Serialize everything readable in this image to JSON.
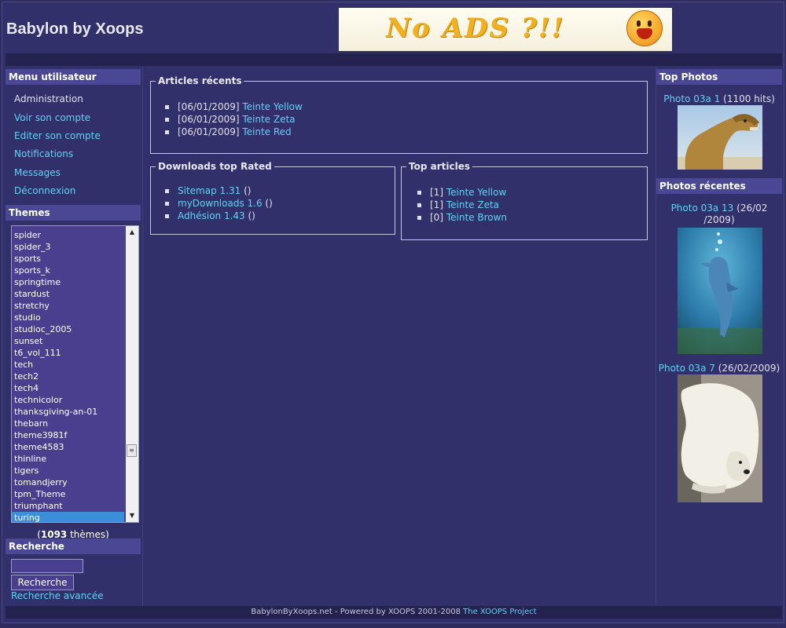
{
  "header": {
    "site_title": "Babylon by Xoops",
    "banner_text": "No ADS ?!!"
  },
  "user_menu": {
    "title": "Menu utilisateur",
    "items": [
      "Administration",
      "Voir son compte",
      "Editer son compte",
      "Notifications",
      "Messages",
      "Déconnexion"
    ]
  },
  "themes": {
    "title": "Themes",
    "options": [
      "spider",
      "spider_3",
      "sports",
      "sports_k",
      "springtime",
      "stardust",
      "stretchy",
      "studio",
      "studioc_2005",
      "sunset",
      "t6_vol_111",
      "tech",
      "tech2",
      "tech4",
      "technicolor",
      "thanksgiving-an-01",
      "thebarn",
      "theme3981f",
      "theme4583",
      "thinline",
      "tigers",
      "tomandjerry",
      "tpm_Theme",
      "triumphant",
      "turing"
    ],
    "selected": "turing",
    "count": "1093",
    "count_suffix": " thèmes)",
    "count_prefix": "("
  },
  "search": {
    "title": "Recherche",
    "button": "Recherche",
    "advanced": "Recherche avancée"
  },
  "articles_recents": {
    "legend": "Articles récents",
    "items": [
      {
        "date": "[06/01/2009]",
        "title": "Teinte Yellow"
      },
      {
        "date": "[06/01/2009]",
        "title": "Teinte Zeta"
      },
      {
        "date": "[06/01/2009]",
        "title": "Teinte Red"
      }
    ]
  },
  "downloads": {
    "legend": "Downloads top Rated",
    "items": [
      {
        "title": "Sitemap 1.31",
        "suffix": "()"
      },
      {
        "title": "myDownloads 1.6",
        "suffix": "()"
      },
      {
        "title": "Adhésion 1.43",
        "suffix": "()"
      }
    ]
  },
  "top_articles": {
    "legend": "Top articles",
    "items": [
      {
        "rank": "[1]",
        "title": "Teinte Yellow"
      },
      {
        "rank": "[1]",
        "title": "Teinte Zeta"
      },
      {
        "rank": "[0]",
        "title": "Teinte Brown"
      }
    ]
  },
  "top_photos": {
    "title": "Top Photos",
    "caption_link": "Photo 03a 1",
    "caption_hits": "(1100 hits)"
  },
  "recent_photos": {
    "title": "Photos récentes",
    "photo1_link": "Photo 03a 13",
    "photo1_date_a": "(26/02",
    "photo1_date_b": "/2009)",
    "photo2_link": "Photo 03a 7",
    "photo2_date": "(26/02/2009)"
  },
  "footer": {
    "text": "BabylonByXoops.net - Powered by XOOPS 2001-2008 ",
    "link": "The XOOPS Project"
  }
}
